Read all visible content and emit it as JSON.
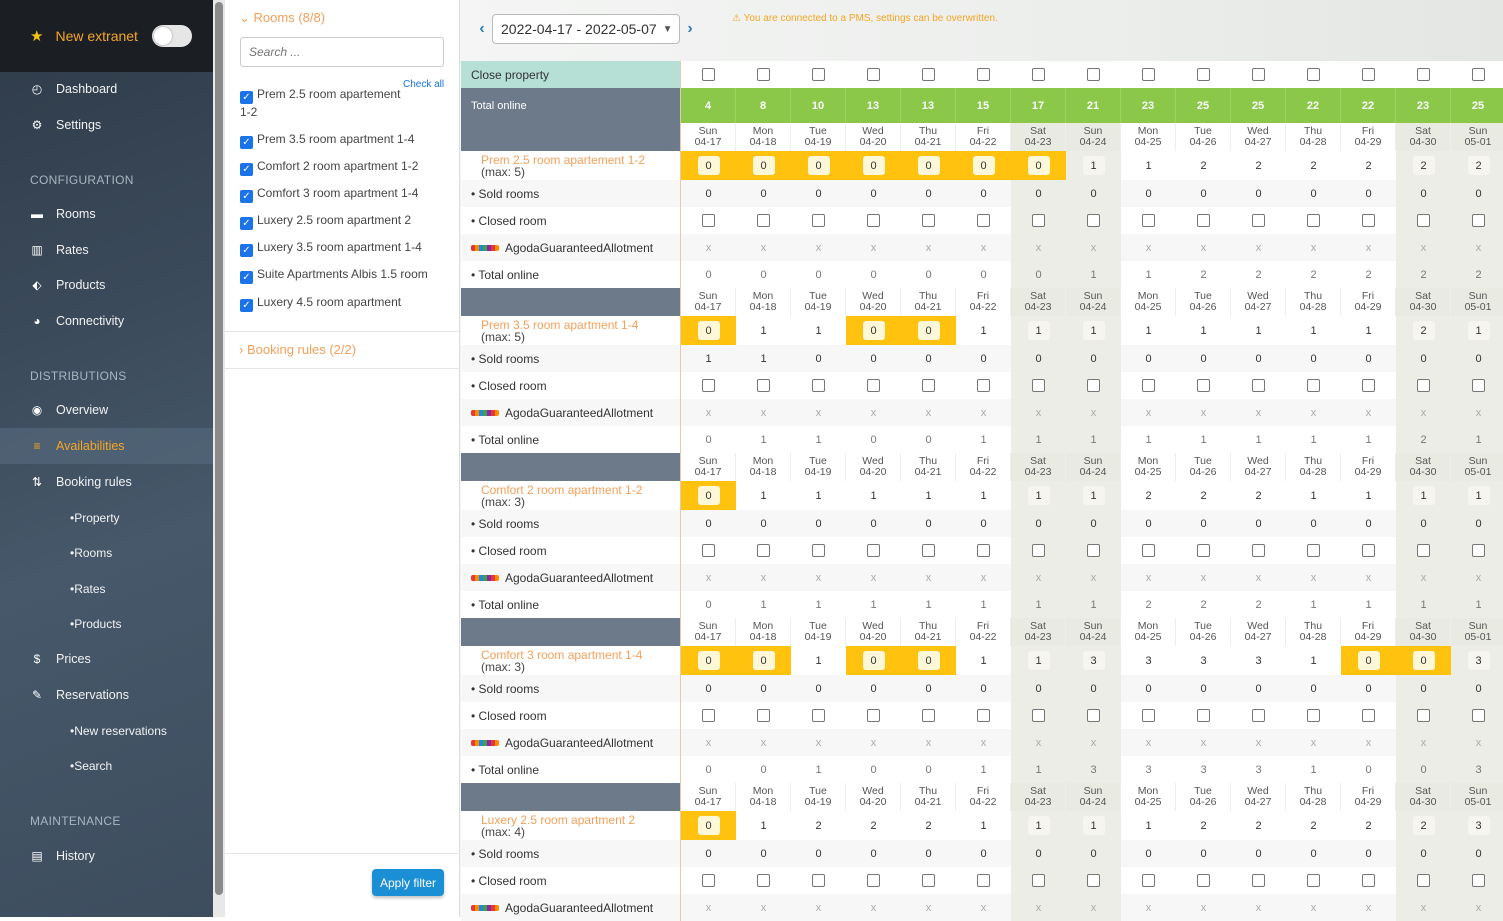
{
  "sidebar": {
    "top": {
      "label": "New extranet",
      "toggle_on": false
    },
    "items": [
      {
        "label": "Dashboard",
        "icon": "dashboard-icon"
      },
      {
        "label": "Settings",
        "icon": "gear-icon"
      }
    ],
    "config_header": "CONFIGURATION",
    "config_items": [
      {
        "label": "Rooms",
        "icon": "bed-icon"
      },
      {
        "label": "Rates",
        "icon": "barcode-icon"
      },
      {
        "label": "Products",
        "icon": "tags-icon"
      },
      {
        "label": "Connectivity",
        "icon": "globe-icon"
      }
    ],
    "dist_header": "DISTRIBUTIONS",
    "dist_items": [
      {
        "label": "Overview",
        "icon": "eye-icon"
      },
      {
        "label": "Availabilities",
        "icon": "list-icon"
      },
      {
        "label": "Booking rules",
        "icon": "sort-icon"
      }
    ],
    "booking_subs": [
      "Property",
      "Rooms",
      "Rates",
      "Products"
    ],
    "more_items": [
      {
        "label": "Prices",
        "icon": "dollar-icon"
      },
      {
        "label": "Reservations",
        "icon": "pin-icon"
      }
    ],
    "reservation_subs": [
      "New reservations",
      "Search"
    ],
    "maint_header": "MAINTENANCE",
    "maint_items": [
      {
        "label": "History",
        "icon": "print-icon"
      }
    ]
  },
  "filter": {
    "rooms_header": "Rooms (8/8)",
    "search_placeholder": "Search ...",
    "check_all": "Check all",
    "rooms": [
      "Prem 2.5 room apartement 1-2",
      "Prem 3.5 room apartment 1-4",
      "Comfort 2 room apartment 1-2",
      "Comfort 3 room apartment 1-4",
      "Luxery 2.5 room apartment 2",
      "Luxery 3.5 room apartment 1-4",
      "Suite Apartments Albis 1.5 room",
      "Luxery 4.5 room apartment"
    ],
    "booking_rules_header": "Booking rules (2/2)",
    "apply_label": "Apply filter"
  },
  "toolbar": {
    "date_range": "2022-04-17 - 2022-05-07",
    "warning": "You are connected to a PMS, settings can be overwritten."
  },
  "grid": {
    "close_label": "Close property",
    "total_online_label": "Total online",
    "total_online": [
      "4",
      "8",
      "10",
      "13",
      "13",
      "15",
      "17",
      "21",
      "23",
      "25",
      "25",
      "22",
      "22",
      "23",
      "25"
    ],
    "days": [
      {
        "d": "Sun",
        "date": "04-17"
      },
      {
        "d": "Mon",
        "date": "04-18"
      },
      {
        "d": "Tue",
        "date": "04-19"
      },
      {
        "d": "Wed",
        "date": "04-20"
      },
      {
        "d": "Thu",
        "date": "04-21"
      },
      {
        "d": "Fri",
        "date": "04-22"
      },
      {
        "d": "Sat",
        "date": "04-23"
      },
      {
        "d": "Sun",
        "date": "04-24"
      },
      {
        "d": "Mon",
        "date": "04-25"
      },
      {
        "d": "Tue",
        "date": "04-26"
      },
      {
        "d": "Wed",
        "date": "04-27"
      },
      {
        "d": "Thu",
        "date": "04-28"
      },
      {
        "d": "Fri",
        "date": "04-29"
      },
      {
        "d": "Sat",
        "date": "04-30"
      },
      {
        "d": "Sun",
        "date": "05-01"
      }
    ],
    "sub_labels": {
      "sold": "• Sold rooms",
      "closed": "• Closed room",
      "agoda": "AgodaGuaranteedAllotment",
      "total": "• Total online"
    },
    "rooms": [
      {
        "name": "Prem 2.5 room apartement 1-2",
        "max": "(max: 5)",
        "avail": [
          "0",
          "0",
          "0",
          "0",
          "0",
          "0",
          "0",
          "1",
          "1",
          "2",
          "2",
          "2",
          "2",
          "2",
          "2"
        ],
        "sold": [
          "0",
          "0",
          "0",
          "0",
          "0",
          "0",
          "0",
          "0",
          "0",
          "0",
          "0",
          "0",
          "0",
          "0",
          "0"
        ],
        "total": [
          "0",
          "0",
          "0",
          "0",
          "0",
          "0",
          "0",
          "1",
          "1",
          "2",
          "2",
          "2",
          "2",
          "2",
          "2"
        ]
      },
      {
        "name": "Prem 3.5 room apartment 1-4",
        "max": "(max: 5)",
        "avail": [
          "0",
          "1",
          "1",
          "0",
          "0",
          "1",
          "1",
          "1",
          "1",
          "1",
          "1",
          "1",
          "1",
          "2",
          "1"
        ],
        "sold": [
          "1",
          "1",
          "0",
          "0",
          "0",
          "0",
          "0",
          "0",
          "0",
          "0",
          "0",
          "0",
          "0",
          "0",
          "0"
        ],
        "total": [
          "0",
          "1",
          "1",
          "0",
          "0",
          "1",
          "1",
          "1",
          "1",
          "1",
          "1",
          "1",
          "1",
          "2",
          "1"
        ]
      },
      {
        "name": "Comfort 2 room apartment 1-2",
        "max": "(max: 3)",
        "avail": [
          "0",
          "1",
          "1",
          "1",
          "1",
          "1",
          "1",
          "1",
          "2",
          "2",
          "2",
          "1",
          "1",
          "1",
          "1"
        ],
        "sold": [
          "0",
          "0",
          "0",
          "0",
          "0",
          "0",
          "0",
          "0",
          "0",
          "0",
          "0",
          "0",
          "0",
          "0",
          "0"
        ],
        "total": [
          "0",
          "1",
          "1",
          "1",
          "1",
          "1",
          "1",
          "1",
          "2",
          "2",
          "2",
          "1",
          "1",
          "1",
          "1"
        ]
      },
      {
        "name": "Comfort 3 room apartment 1-4",
        "max": "(max: 3)",
        "avail": [
          "0",
          "0",
          "1",
          "0",
          "0",
          "1",
          "1",
          "3",
          "3",
          "3",
          "3",
          "1",
          "0",
          "0",
          "3"
        ],
        "sold": [
          "0",
          "0",
          "0",
          "0",
          "0",
          "0",
          "0",
          "0",
          "0",
          "0",
          "0",
          "0",
          "0",
          "0",
          "0"
        ],
        "total": [
          "0",
          "0",
          "1",
          "0",
          "0",
          "1",
          "1",
          "3",
          "3",
          "3",
          "3",
          "1",
          "0",
          "0",
          "3"
        ]
      },
      {
        "name": "Luxery 2.5 room apartment 2",
        "max": "(max: 4)",
        "avail": [
          "0",
          "1",
          "2",
          "2",
          "2",
          "1",
          "1",
          "1",
          "1",
          "2",
          "2",
          "2",
          "2",
          "2",
          "3"
        ],
        "sold": [
          "0",
          "0",
          "0",
          "0",
          "0",
          "0",
          "0",
          "0",
          "0",
          "0",
          "0",
          "0",
          "0",
          "0",
          "0"
        ],
        "total": []
      }
    ]
  },
  "colors": {
    "accent": "#f5a05a",
    "green": "#8bc84a",
    "yellow": "#ffc20e",
    "slate": "#6c7a89",
    "blue": "#1a8fd6"
  }
}
